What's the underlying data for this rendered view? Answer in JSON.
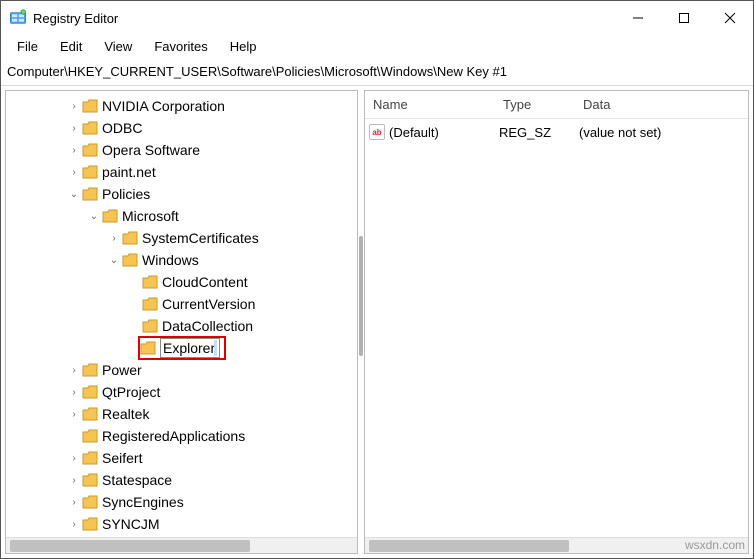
{
  "window": {
    "title": "Registry Editor"
  },
  "menu": {
    "file": "File",
    "edit": "Edit",
    "view": "View",
    "favorites": "Favorites",
    "help": "Help"
  },
  "address": "Computer\\HKEY_CURRENT_USER\\Software\\Policies\\Microsoft\\Windows\\New Key #1",
  "tree": {
    "nvidia": "NVIDIA Corporation",
    "odbc": "ODBC",
    "opera": "Opera Software",
    "paintnet": "paint.net",
    "policies": "Policies",
    "microsoft": "Microsoft",
    "systemcerts": "SystemCertificates",
    "windows": "Windows",
    "cloudcontent": "CloudContent",
    "currentversion": "CurrentVersion",
    "datacollection": "DataCollection",
    "explorer_edit": "Explorer",
    "power": "Power",
    "qtproject": "QtProject",
    "realtek": "Realtek",
    "regapps": "RegisteredApplications",
    "seifert": "Seifert",
    "statespace": "Statespace",
    "syncengines": "SyncEngines",
    "syncjm": "SYNCJM"
  },
  "list": {
    "header": {
      "name": "Name",
      "type": "Type",
      "data": "Data"
    },
    "rows": [
      {
        "name": "(Default)",
        "type": "REG_SZ",
        "data": "(value not set)"
      }
    ]
  },
  "string_icon_text": "ab",
  "watermark": "wsxdn.com"
}
